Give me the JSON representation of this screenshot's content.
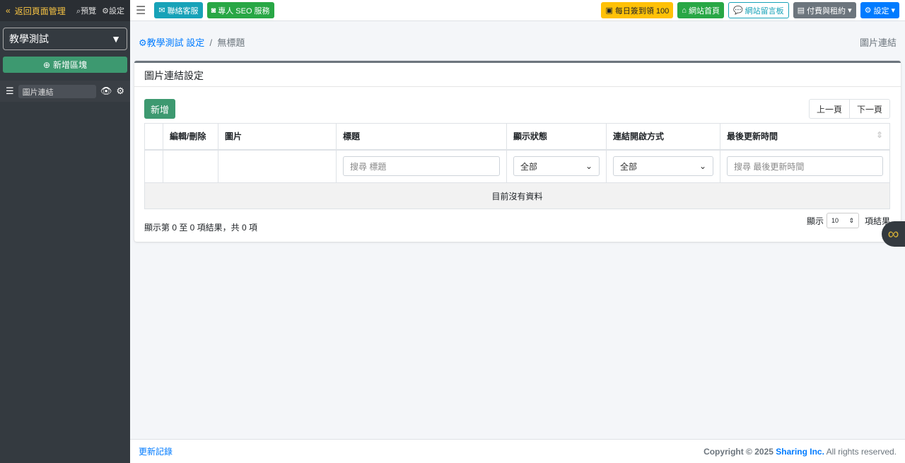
{
  "sidebar": {
    "back": "返回頁面管理",
    "preview": "預覽",
    "settings": "設定",
    "site_select": "教學測試",
    "add_block": "新增區塊",
    "items": [
      {
        "label": "圖片連結"
      }
    ]
  },
  "topbar": {
    "contact": "聯絡客服",
    "seo": "專人 SEO 服務",
    "checkin": "每日簽到領 100",
    "home": "網站首頁",
    "board": "網站留言板",
    "billing": "付費與租約",
    "settings": "設定"
  },
  "breadcrumb": {
    "site": "教學測試 設定",
    "current": "無標題",
    "right": "圖片連結"
  },
  "card": {
    "title": "圖片連結設定",
    "new": "新增",
    "prev": "上一頁",
    "next": "下一頁",
    "columns": [
      "",
      "編輯/刪除",
      "圖片",
      "標題",
      "顯示狀態",
      "連結開啟方式",
      "最後更新時間"
    ],
    "filters": {
      "title_placeholder": "搜尋 標題",
      "status": "全部",
      "open": "全部",
      "time_placeholder": "搜尋 最後更新時間"
    },
    "empty": "目前沒有資料",
    "info": "顯示第 0 至 0 項結果，共 0 項",
    "length_prefix": "顯示",
    "length_value": "10",
    "length_suffix": "項結果"
  },
  "footer": {
    "changelog": "更新記錄",
    "copyright": "Copyright © 2025 ",
    "company": "Sharing Inc.",
    "rights": " All rights reserved."
  }
}
